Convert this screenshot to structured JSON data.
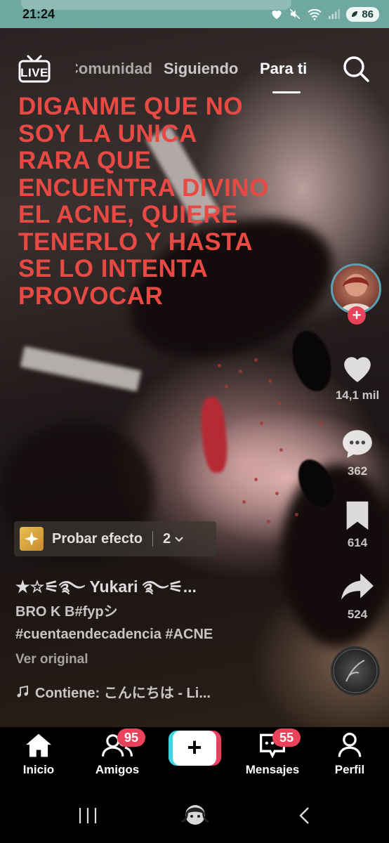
{
  "status_bar": {
    "time": "21:24",
    "battery": "86",
    "icons": [
      "heart-icon",
      "mute-icon",
      "wifi-icon",
      "signal-icon",
      "battery-icon"
    ]
  },
  "top_nav": {
    "live_label": "LIVE",
    "tabs": [
      {
        "label": "Comunidad"
      },
      {
        "label": "Siguiendo"
      },
      {
        "label": "Para ti",
        "active": true
      }
    ]
  },
  "video": {
    "overlay_text": "DIGANME QUE NO SOY LA UNICA RARA QUE ENCUENTRA DIVINO EL ACNE, QUIERE TENERLO Y HASTA SE LO INTENTA PROVOCAR"
  },
  "rail": {
    "likes": "14,1 mil",
    "comments": "362",
    "saves": "614",
    "shares": "524"
  },
  "effect": {
    "label": "Probar efecto",
    "count": "2"
  },
  "post": {
    "username": "★☆⚟࿐ Yukari ࿐⚟...",
    "caption_line1": "BRO K B#fypシ",
    "caption_line2": "#cuentaendecadencia #ACNE",
    "see_original": "Ver original",
    "sound": "Contiene: こんにちは - Li..."
  },
  "bottom_nav": {
    "items": [
      {
        "label": "Inicio",
        "active": true
      },
      {
        "label": "Amigos",
        "badge": "95"
      },
      {
        "label": "+"
      },
      {
        "label": "Mensajes",
        "badge": "55"
      },
      {
        "label": "Perfil"
      }
    ]
  },
  "colors": {
    "overlay_text": "#e84a43",
    "badge": "#e8435a",
    "status_bar": "#6ea8a0",
    "create_cyan": "#3fd6e4",
    "create_red": "#ea3f5e"
  }
}
